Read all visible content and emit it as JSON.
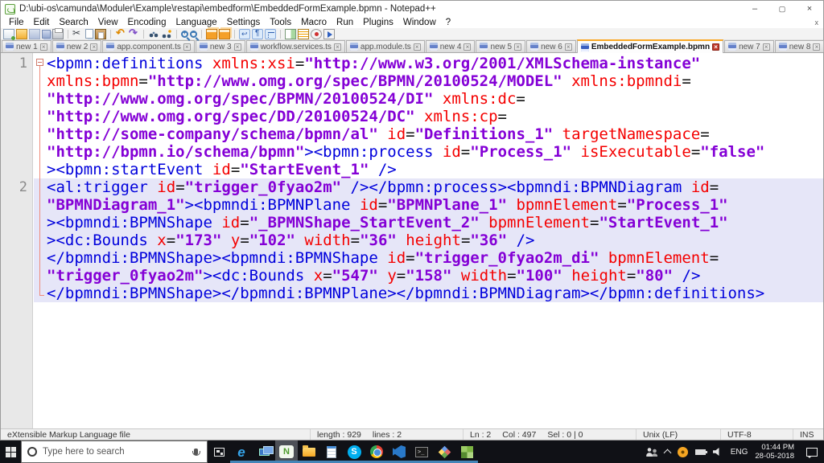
{
  "window": {
    "title": "D:\\ubi-os\\camunda\\Moduler\\Example\\restapi\\embedform\\EmbeddedFormExample.bpmn - Notepad++",
    "minimize": "–",
    "maximize": "",
    "close": "×",
    "doc_close": "x"
  },
  "menu": {
    "items": [
      "File",
      "Edit",
      "Search",
      "View",
      "Encoding",
      "Language",
      "Settings",
      "Tools",
      "Macro",
      "Run",
      "Plugins",
      "Window",
      "?"
    ]
  },
  "toolbar": {
    "icons": [
      "new-file",
      "open-file",
      "save",
      "save-all",
      "print",
      "cut",
      "copy",
      "paste",
      "undo",
      "redo",
      "find",
      "replace",
      "zoom-in",
      "zoom-out",
      "sync-scroll-vertical",
      "sync-scroll-horizontal",
      "word-wrap",
      "show-all-characters",
      "indent-guide",
      "document-map",
      "function-list",
      "record-macro",
      "play-macro"
    ]
  },
  "tabs": [
    {
      "label": "new 1",
      "active": false
    },
    {
      "label": "new 2",
      "active": false
    },
    {
      "label": "app.component.ts",
      "active": false
    },
    {
      "label": "new 3",
      "active": false
    },
    {
      "label": "workflow.services.ts",
      "active": false
    },
    {
      "label": "app.module.ts",
      "active": false
    },
    {
      "label": "new 4",
      "active": false
    },
    {
      "label": "new 5",
      "active": false
    },
    {
      "label": "new 6",
      "active": false
    },
    {
      "label": "EmbeddedFormExample.bpmn",
      "active": true
    },
    {
      "label": "new 7",
      "active": false
    },
    {
      "label": "new 8",
      "active": false
    }
  ],
  "editor": {
    "colors": {
      "tag": "#0000dc",
      "attribute": "#f40000",
      "value": "#8400d6",
      "plain": "#111111",
      "caret_line": "#e6e6f8"
    },
    "lines": [
      {
        "number": "1",
        "highlight": false,
        "rows": [
          [
            [
              "t",
              "<bpmn:definitions"
            ],
            [
              "e",
              " "
            ],
            [
              "a",
              "xmlns:xsi"
            ],
            [
              "e",
              "="
            ],
            [
              "v",
              "\"http://www.w3.org/2001/XMLSchema-instance\""
            ]
          ],
          [
            [
              "a",
              "xmlns:bpmn"
            ],
            [
              "e",
              "="
            ],
            [
              "v",
              "\"http://www.omg.org/spec/BPMN/20100524/MODEL\""
            ],
            [
              "e",
              " "
            ],
            [
              "a",
              "xmlns:bpmndi"
            ],
            [
              "e",
              "="
            ]
          ],
          [
            [
              "v",
              "\"http://www.omg.org/spec/BPMN/20100524/DI\""
            ],
            [
              "e",
              " "
            ],
            [
              "a",
              "xmlns:dc"
            ],
            [
              "e",
              "="
            ]
          ],
          [
            [
              "v",
              "\"http://www.omg.org/spec/DD/20100524/DC\""
            ],
            [
              "e",
              " "
            ],
            [
              "a",
              "xmlns:cp"
            ],
            [
              "e",
              "="
            ]
          ],
          [
            [
              "v",
              "\"http://some-company/schema/bpmn/al\""
            ],
            [
              "e",
              " "
            ],
            [
              "a",
              "id"
            ],
            [
              "e",
              "="
            ],
            [
              "v",
              "\"Definitions_1\""
            ],
            [
              "e",
              " "
            ],
            [
              "a",
              "targetNamespace"
            ],
            [
              "e",
              "="
            ]
          ],
          [
            [
              "v",
              "\"http://bpmn.io/schema/bpmn\""
            ],
            [
              "t",
              "><bpmn:process"
            ],
            [
              "e",
              " "
            ],
            [
              "a",
              "id"
            ],
            [
              "e",
              "="
            ],
            [
              "v",
              "\"Process_1\""
            ],
            [
              "e",
              " "
            ],
            [
              "a",
              "isExecutable"
            ],
            [
              "e",
              "="
            ],
            [
              "v",
              "\"false\""
            ]
          ],
          [
            [
              "t",
              "><bpmn:startEvent"
            ],
            [
              "e",
              " "
            ],
            [
              "a",
              "id"
            ],
            [
              "e",
              "="
            ],
            [
              "v",
              "\"StartEvent_1\""
            ],
            [
              "t",
              " />"
            ]
          ]
        ]
      },
      {
        "number": "2",
        "highlight": true,
        "rows": [
          [
            [
              "t",
              "<al:trigger"
            ],
            [
              "e",
              " "
            ],
            [
              "a",
              "id"
            ],
            [
              "e",
              "="
            ],
            [
              "v",
              "\"trigger_0fyao2m\""
            ],
            [
              "t",
              " /></bpmn:process><bpmndi:BPMNDiagram"
            ],
            [
              "e",
              " "
            ],
            [
              "a",
              "id"
            ],
            [
              "e",
              "="
            ]
          ],
          [
            [
              "v",
              "\"BPMNDiagram_1\""
            ],
            [
              "t",
              "><bpmndi:BPMNPlane"
            ],
            [
              "e",
              " "
            ],
            [
              "a",
              "id"
            ],
            [
              "e",
              "="
            ],
            [
              "v",
              "\"BPMNPlane_1\""
            ],
            [
              "e",
              " "
            ],
            [
              "a",
              "bpmnElement"
            ],
            [
              "e",
              "="
            ],
            [
              "v",
              "\"Process_1\""
            ]
          ],
          [
            [
              "t",
              "><bpmndi:BPMNShape"
            ],
            [
              "e",
              " "
            ],
            [
              "a",
              "id"
            ],
            [
              "e",
              "="
            ],
            [
              "v",
              "\"_BPMNShape_StartEvent_2\""
            ],
            [
              "e",
              " "
            ],
            [
              "a",
              "bpmnElement"
            ],
            [
              "e",
              "="
            ],
            [
              "v",
              "\"StartEvent_1\""
            ]
          ],
          [
            [
              "t",
              "><dc:Bounds"
            ],
            [
              "e",
              " "
            ],
            [
              "a",
              "x"
            ],
            [
              "e",
              "="
            ],
            [
              "v",
              "\"173\""
            ],
            [
              "e",
              " "
            ],
            [
              "a",
              "y"
            ],
            [
              "e",
              "="
            ],
            [
              "v",
              "\"102\""
            ],
            [
              "e",
              " "
            ],
            [
              "a",
              "width"
            ],
            [
              "e",
              "="
            ],
            [
              "v",
              "\"36\""
            ],
            [
              "e",
              " "
            ],
            [
              "a",
              "height"
            ],
            [
              "e",
              "="
            ],
            [
              "v",
              "\"36\""
            ],
            [
              "t",
              " />"
            ]
          ],
          [
            [
              "t",
              "</bpmndi:BPMNShape><bpmndi:BPMNShape"
            ],
            [
              "e",
              " "
            ],
            [
              "a",
              "id"
            ],
            [
              "e",
              "="
            ],
            [
              "v",
              "\"trigger_0fyao2m_di\""
            ],
            [
              "e",
              " "
            ],
            [
              "a",
              "bpmnElement"
            ],
            [
              "e",
              "="
            ]
          ],
          [
            [
              "v",
              "\"trigger_0fyao2m\""
            ],
            [
              "t",
              "><dc:Bounds"
            ],
            [
              "e",
              " "
            ],
            [
              "a",
              "x"
            ],
            [
              "e",
              "="
            ],
            [
              "v",
              "\"547\""
            ],
            [
              "e",
              " "
            ],
            [
              "a",
              "y"
            ],
            [
              "e",
              "="
            ],
            [
              "v",
              "\"158\""
            ],
            [
              "e",
              " "
            ],
            [
              "a",
              "width"
            ],
            [
              "e",
              "="
            ],
            [
              "v",
              "\"100\""
            ],
            [
              "e",
              " "
            ],
            [
              "a",
              "height"
            ],
            [
              "e",
              "="
            ],
            [
              "v",
              "\"80\""
            ],
            [
              "t",
              " />"
            ]
          ],
          [
            [
              "t",
              "</bpmndi:BPMNShape></bpmndi:BPMNPlane></bpmndi:BPMNDiagram></bpmn:definitions>"
            ]
          ]
        ]
      }
    ]
  },
  "status_bar": {
    "doc_type": "eXtensible Markup Language file",
    "length": "length : 929",
    "lines": "lines : 2",
    "ln": "Ln : 2",
    "col": "Col : 497",
    "sel": "Sel : 0 | 0",
    "eol": "Unix (LF)",
    "encoding": "UTF-8",
    "insert_mode": "INS"
  },
  "taskbar": {
    "search_placeholder": "Type here to search",
    "edge_letter": "e",
    "npp_letter": "N",
    "skype_letter": "S",
    "terminal_text": ">_",
    "apps": [
      {
        "name": "edge",
        "cls": "a-edge",
        "text": "e"
      },
      {
        "name": "remote-desktop",
        "cls": "a-remote",
        "text": ""
      },
      {
        "name": "notepad-plus-plus",
        "cls": "a-npp",
        "text": "N",
        "active": true
      },
      {
        "name": "file-explorer",
        "cls": "a-folder",
        "text": ""
      },
      {
        "name": "notepad",
        "cls": "a-notepad",
        "text": ""
      },
      {
        "name": "skype",
        "cls": "a-skype",
        "text": "S"
      },
      {
        "name": "chrome",
        "cls": "a-chrome",
        "text": ""
      },
      {
        "name": "vscode",
        "cls": "a-vscode",
        "text": ""
      },
      {
        "name": "terminal",
        "cls": "a-terminal",
        "text": ">_"
      },
      {
        "name": "diamond-modeler",
        "cls": "a-diamond",
        "text": ""
      },
      {
        "name": "green-grid-app",
        "cls": "a-green",
        "text": ""
      }
    ],
    "tray": {
      "language": "ENG",
      "time": "01:44 PM",
      "date": "28-05-2018"
    }
  }
}
